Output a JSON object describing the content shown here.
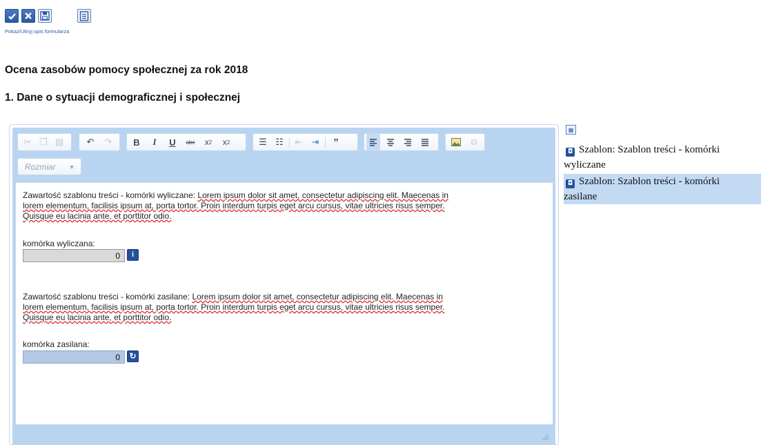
{
  "toolbar_top": {
    "toggle_label": "Pokaż/Ukryj opis formularza",
    "icons": [
      "check-icon",
      "close-icon",
      "save-icon",
      "form-description-icon"
    ]
  },
  "header": {
    "title": "Ocena zasobów pomocy społecznej za rok 2018",
    "section": "1. Dane o sytuacji demograficznej i społecznej"
  },
  "editor": {
    "toolbar": {
      "size_combo": "Rozmiar",
      "buttons": [
        "cut",
        "copy",
        "paste",
        "undo",
        "redo",
        "bold",
        "italic",
        "underline",
        "strikethrough",
        "subscript",
        "superscript",
        "numbered-list",
        "bulleted-list",
        "outdent",
        "indent",
        "blockquote",
        "align-left",
        "align-center",
        "align-right",
        "justify",
        "image",
        "templates"
      ]
    },
    "blocks": [
      {
        "intro": "Zawartość szablonu treści - komórki wyliczane:",
        "lorem_line1": "Lorem ipsum dolor sit amet, consectetur adipiscing elit. Maecenas in",
        "lorem_line2": "lorem elementum, facilisis ipsum at, porta tortor. Proin interdum turpis eget arcu cursus, vitae ultricies risus semper.",
        "lorem_line3": "Quisque eu lacinia ante, et porttitor odio.",
        "field_label": "komórka wyliczana:",
        "field_value": "0",
        "badge": "i"
      },
      {
        "intro": "Zawartość szablonu treści - komórki zasilane:",
        "lorem_line1": "Lorem ipsum dolor sit amet, consectetur adipiscing elit. Maecenas in",
        "lorem_line2": "lorem elementum, facilisis ipsum at, porta tortor. Proin interdum turpis eget arcu cursus, vitae ultricies risus semper.",
        "lorem_line3": "Quisque eu lacinia ante, et porttitor odio.",
        "field_label": "komórka zasilana:",
        "field_value": "0",
        "badge": "↻"
      }
    ]
  },
  "templates_panel": {
    "items": [
      {
        "label": "Szablon: Szablon treści - komórki wyliczane",
        "line1": "Szablon: Szablon treści - komórki",
        "line2": "wyliczane",
        "selected": false
      },
      {
        "label": "Szablon: Szablon treści - komórki zasilane",
        "line1": "Szablon: Szablon treści - komórki",
        "line2": "zasilane",
        "selected": true
      }
    ]
  },
  "colors": {
    "accent": "#23509a",
    "editor_chrome": "#b9d4f0",
    "selected_row": "#c3daf3",
    "calc_field": "#d9d9d9",
    "feed_field": "#b3c8e2"
  }
}
